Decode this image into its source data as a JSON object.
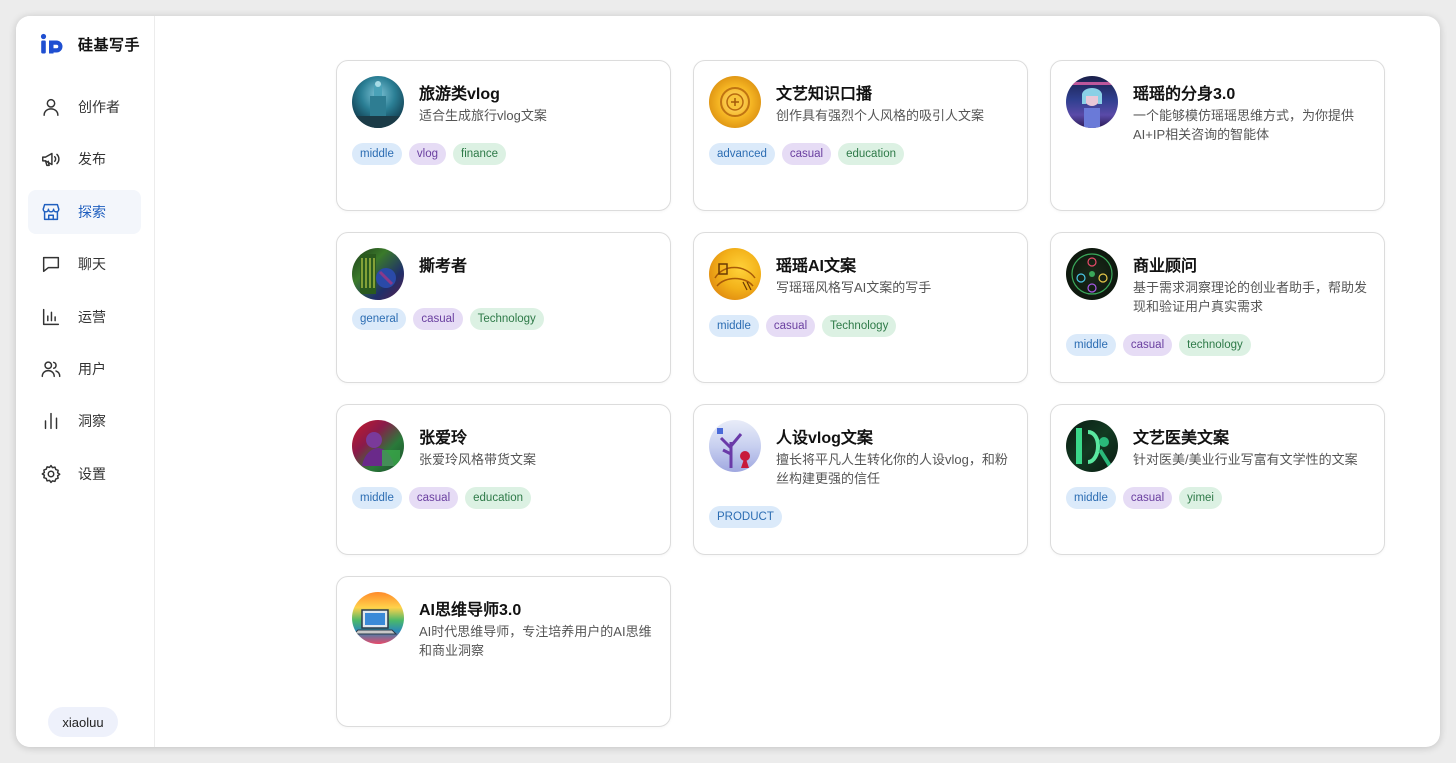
{
  "app": {
    "name": "硅基写手"
  },
  "sidebar": {
    "items": [
      {
        "label": "创作者",
        "icon": "person-icon"
      },
      {
        "label": "发布",
        "icon": "megaphone-icon"
      },
      {
        "label": "探索",
        "icon": "store-icon",
        "active": true
      },
      {
        "label": "聊天",
        "icon": "chat-icon"
      },
      {
        "label": "运营",
        "icon": "bar-chart-icon"
      },
      {
        "label": "用户",
        "icon": "users-icon"
      },
      {
        "label": "洞察",
        "icon": "insight-bars-icon"
      },
      {
        "label": "设置",
        "icon": "gear-icon"
      }
    ],
    "user": "xiaoluu"
  },
  "cards": [
    {
      "title": "旅游类vlog",
      "desc": "适合生成旅行vlog文案",
      "tags": [
        {
          "text": "middle",
          "color": "blue"
        },
        {
          "text": "vlog",
          "color": "purple"
        },
        {
          "text": "finance",
          "color": "green"
        }
      ]
    },
    {
      "title": "文艺知识口播",
      "desc": "创作具有强烈个人风格的吸引人文案",
      "tags": [
        {
          "text": "advanced",
          "color": "blue"
        },
        {
          "text": "casual",
          "color": "purple"
        },
        {
          "text": "education",
          "color": "green"
        }
      ]
    },
    {
      "title": "瑶瑶的分身3.0",
      "desc": "一个能够模仿瑶瑶思维方式，为你提供AI+IP相关咨询的智能体",
      "tags": []
    },
    {
      "title": "撕考者",
      "desc": "",
      "tags": [
        {
          "text": "general",
          "color": "blue"
        },
        {
          "text": "casual",
          "color": "purple"
        },
        {
          "text": "Technology",
          "color": "green"
        }
      ]
    },
    {
      "title": "瑶瑶AI文案",
      "desc": "写瑶瑶风格写AI文案的写手",
      "tags": [
        {
          "text": "middle",
          "color": "blue"
        },
        {
          "text": "casual",
          "color": "purple"
        },
        {
          "text": "Technology",
          "color": "green"
        }
      ]
    },
    {
      "title": "商业顾问",
      "desc": "基于需求洞察理论的创业者助手，帮助发现和验证用户真实需求",
      "tags": [
        {
          "text": "middle",
          "color": "blue"
        },
        {
          "text": "casual",
          "color": "purple"
        },
        {
          "text": "technology",
          "color": "green"
        }
      ]
    },
    {
      "title": "张爱玲",
      "desc": "张爱玲风格带货文案",
      "tags": [
        {
          "text": "middle",
          "color": "blue"
        },
        {
          "text": "casual",
          "color": "purple"
        },
        {
          "text": "education",
          "color": "green"
        }
      ]
    },
    {
      "title": "人设vlog文案",
      "desc": "擅长将平凡人生转化你的人设vlog，和粉丝构建更强的信任",
      "tags": [
        {
          "text": "PRODUCT",
          "color": "blue"
        }
      ]
    },
    {
      "title": "文艺医美文案",
      "desc": "针对医美/美业行业写富有文学性的文案",
      "tags": [
        {
          "text": "middle",
          "color": "blue"
        },
        {
          "text": "casual",
          "color": "purple"
        },
        {
          "text": "yimei",
          "color": "green"
        }
      ]
    },
    {
      "title": "AI思维导师3.0",
      "desc": "AI时代思维导师，专注培养用户的AI思维和商业洞察",
      "tags": []
    }
  ]
}
